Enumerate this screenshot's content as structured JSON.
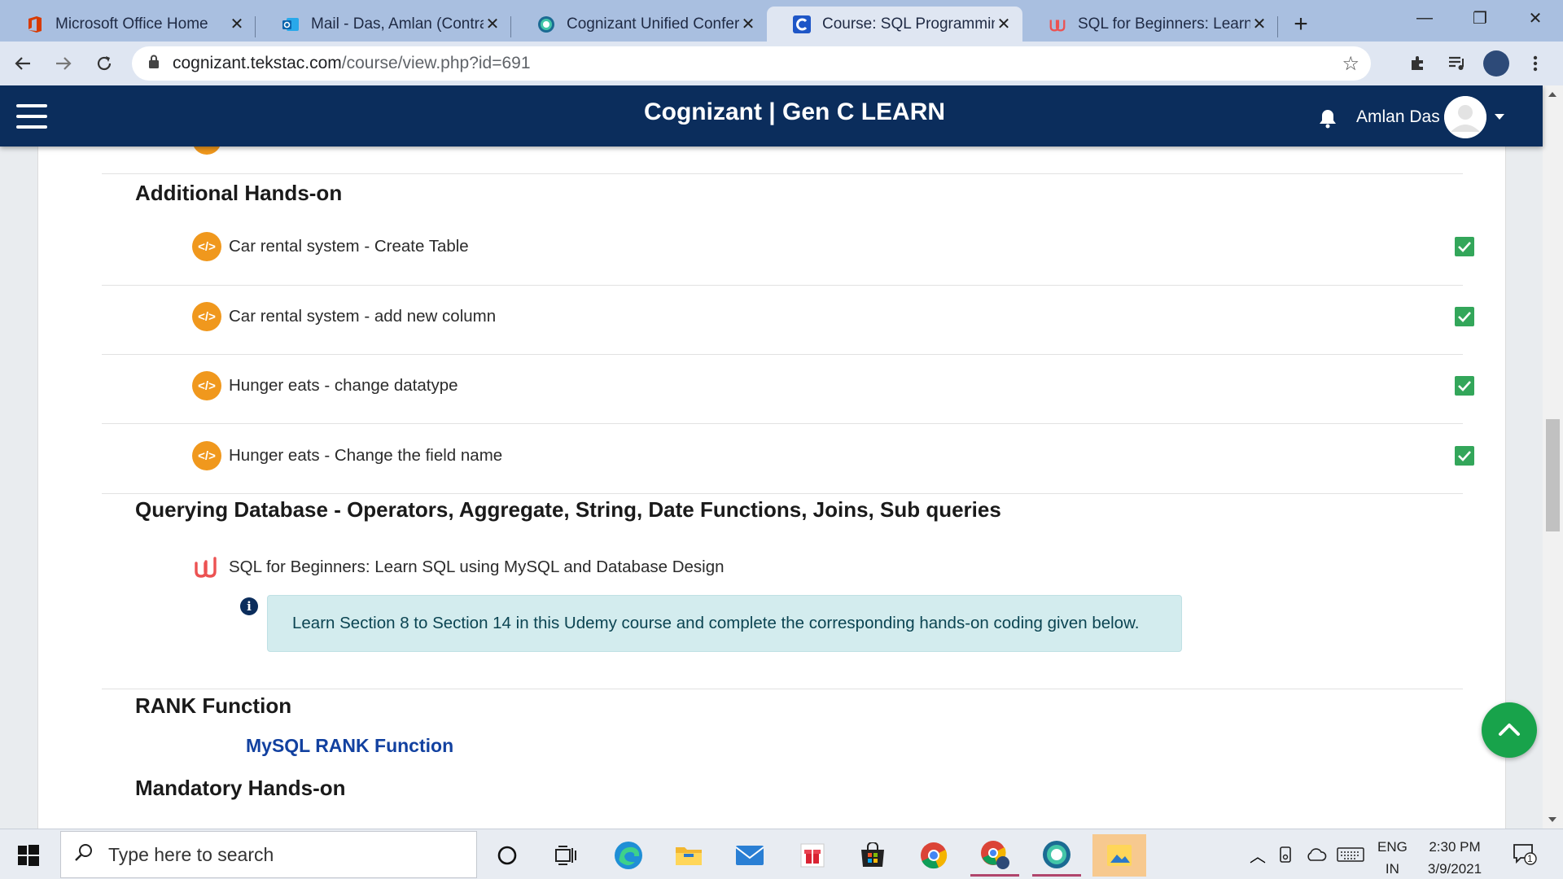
{
  "browser": {
    "tabs": [
      {
        "title": "Microsoft Office Home",
        "icon": "office-icon",
        "active": false
      },
      {
        "title": "Mail - Das, Amlan (Contract",
        "icon": "outlook-icon",
        "active": false
      },
      {
        "title": "Cognizant Unified Conferen",
        "icon": "conference-icon",
        "active": false
      },
      {
        "title": "Course: SQL Programming",
        "icon": "cognizant-icon",
        "active": true
      },
      {
        "title": "SQL for Beginners: Learn SC",
        "icon": "udemy-icon",
        "active": false
      }
    ],
    "new_tab": "+",
    "url_host": "cognizant.tekstac.com",
    "url_path": "/course/view.php?id=691"
  },
  "site": {
    "brand": "Cognizant | Gen C LEARN",
    "user_name": "Amlan Das"
  },
  "sections": {
    "additional": {
      "title": "Additional Hands-on",
      "items": [
        {
          "label": "Car rental system - Create Table",
          "completed": true
        },
        {
          "label": "Car rental system - add new column",
          "completed": true
        },
        {
          "label": "Hunger eats - change datatype",
          "completed": true
        },
        {
          "label": "Hunger eats - Change the field name",
          "completed": true
        }
      ]
    },
    "querying": {
      "title": "Querying Database - Operators, Aggregate, String, Date Functions, Joins, Sub queries",
      "course_label": "SQL for Beginners: Learn SQL using MySQL and Database Design",
      "info_text": "Learn Section 8 to Section 14 in this Udemy course and complete the corresponding hands-on coding given below."
    },
    "rank": {
      "title": "RANK Function",
      "link_label": "MySQL RANK Function"
    },
    "mandatory": {
      "title": "Mandatory Hands-on"
    }
  },
  "taskbar": {
    "search_placeholder": "Type here to search",
    "lang_line1": "ENG",
    "lang_line2": "IN",
    "time": "2:30 PM",
    "date": "3/9/2021",
    "notification_count": "1"
  },
  "colors": {
    "nav_bg": "#0b2d5c",
    "activity_icon": "#f0981d",
    "check_green": "#33a65a",
    "info_bg": "#d3ecee",
    "link_blue": "#1241a0",
    "scroll_top_green": "#18a34b"
  }
}
